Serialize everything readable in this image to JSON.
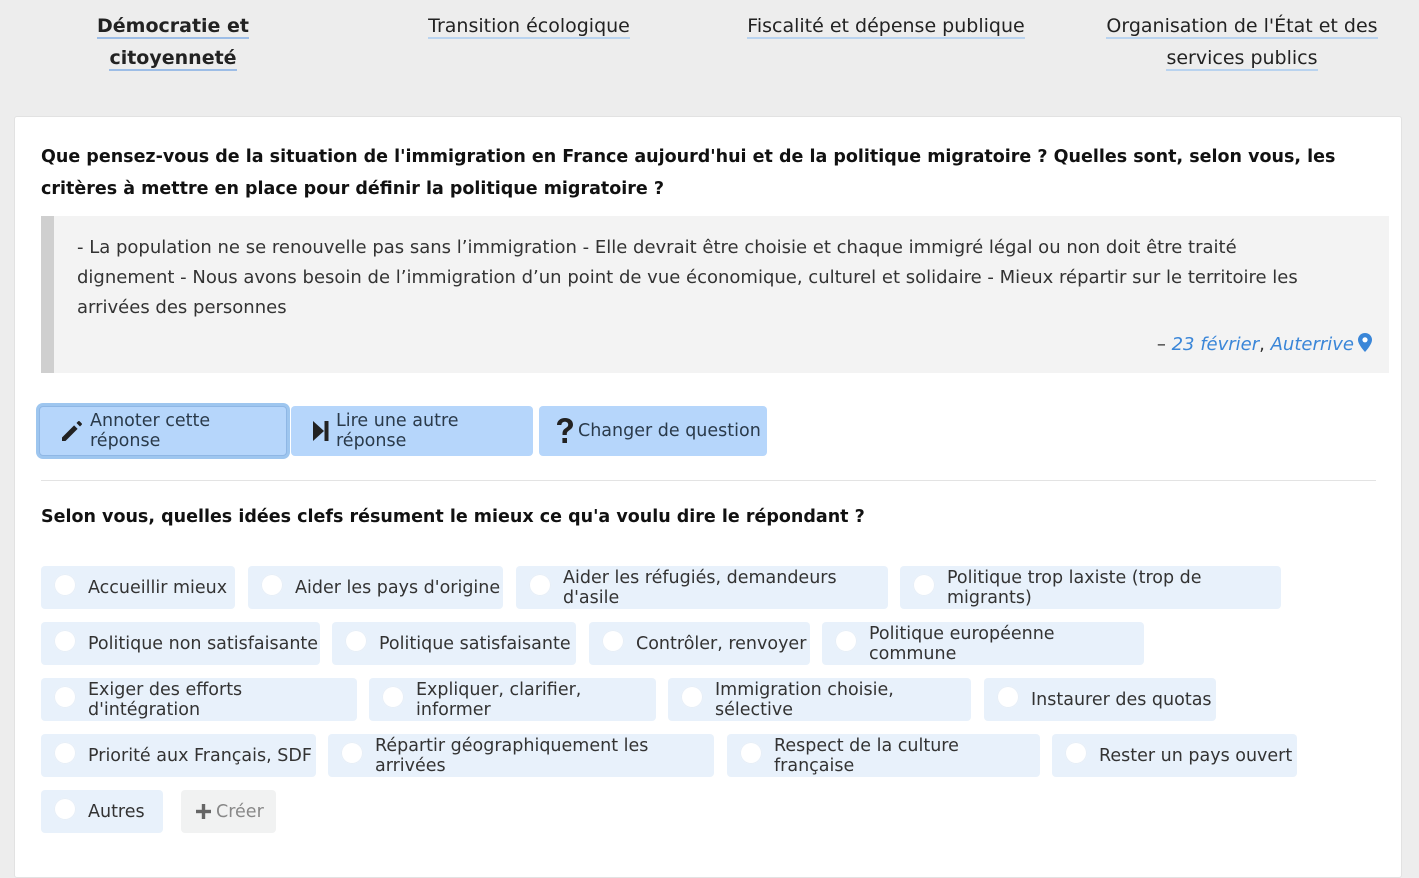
{
  "nav": {
    "items": [
      {
        "label": "Démocratie et citoyenneté"
      },
      {
        "label": "Transition écologique"
      },
      {
        "label": "Fiscalité et dépense publique"
      },
      {
        "label": "Organisation de l'État et des services publics"
      }
    ],
    "active": "Démocratie et citoyenneté"
  },
  "question": "Que pensez-vous de la situation de l'immigration en France aujourd'hui et de la politique migratoire ? Quelles sont, selon vous, les critères à mettre en place pour définir la politique migratoire ?",
  "response": {
    "text": "- La population ne se renouvelle pas sans l’immigration - Elle devrait être choisie et chaque immigré légal ou non doit être traité dignement - Nous avons besoin de l’immigration d’un point de vue économique, culturel et solidaire - Mieux répartir sur le territoire les arrivées des personnes",
    "dash": "–",
    "date": "23 février",
    "separator": ",",
    "location": "Auterrive",
    "link_color": "#3a86d8"
  },
  "actions": {
    "annotate": "Annoter cette réponse",
    "next": "Lire une autre réponse",
    "change": "Changer de question"
  },
  "prompt": "Selon vous, quelles idées clefs résument le mieux ce qu'a voulu dire le répondant ?",
  "tags": [
    "Accueillir mieux",
    "Aider les pays d'origine",
    "Aider les réfugiés, demandeurs d'asile",
    "Politique trop laxiste (trop de migrants)",
    "Politique non satisfaisante",
    "Politique satisfaisante",
    "Contrôler, renvoyer",
    "Politique européenne commune",
    "Exiger des efforts d'intégration",
    "Expliquer, clarifier, informer",
    "Immigration choisie, sélective",
    "Instaurer des quotas",
    "Priorité aux Français, SDF",
    "Répartir géographiquement les arrivées",
    "Respect de la culture française",
    "Rester un pays ouvert",
    "Autres"
  ],
  "create_label": "Créer",
  "colors": {
    "button_bg": "#b6d6fb",
    "tag_bg": "#e8f1fb",
    "accent": "#3a86d8"
  }
}
